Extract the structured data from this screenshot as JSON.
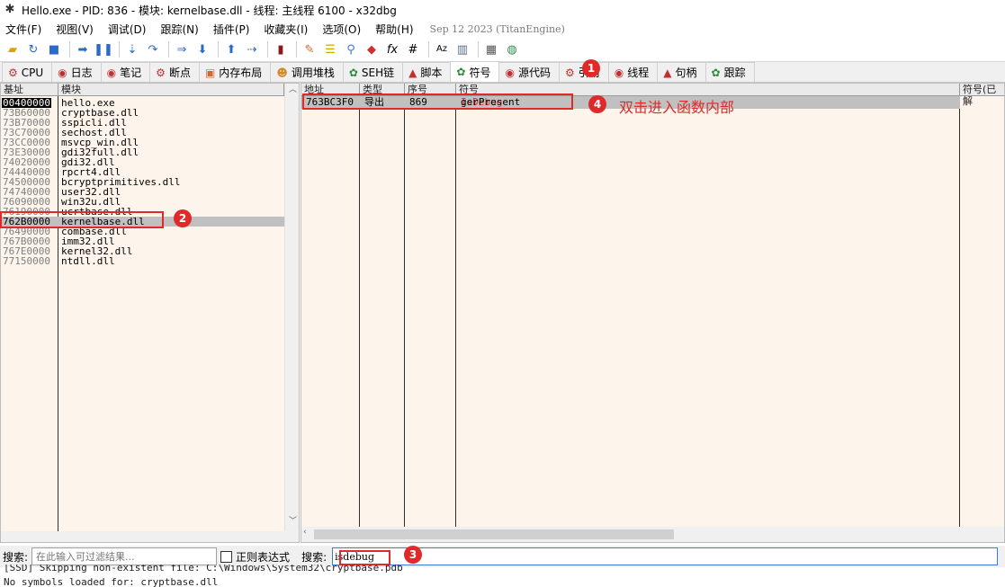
{
  "window": {
    "title": "Hello.exe - PID: 836 - 模块: kernelbase.dll - 线程: 主线程 6100 - x32dbg"
  },
  "menu": {
    "items": [
      "文件(F)",
      "视图(V)",
      "调试(D)",
      "跟踪(N)",
      "插件(P)",
      "收藏夹(I)",
      "选项(O)",
      "帮助(H)"
    ],
    "build": "Sep 12 2023 (TitanEngine)"
  },
  "tabs": [
    {
      "label": "CPU",
      "icon": "cpu-icon"
    },
    {
      "label": "日志",
      "icon": "log-icon"
    },
    {
      "label": "笔记",
      "icon": "notes-icon"
    },
    {
      "label": "断点",
      "icon": "breakpoint-icon"
    },
    {
      "label": "内存布局",
      "icon": "memory-map-icon"
    },
    {
      "label": "调用堆栈",
      "icon": "call-stack-icon"
    },
    {
      "label": "SEH链",
      "icon": "seh-icon"
    },
    {
      "label": "脚本",
      "icon": "script-icon"
    },
    {
      "label": "符号",
      "icon": "symbols-icon"
    },
    {
      "label": "源代码",
      "icon": "source-icon"
    },
    {
      "label": "引用",
      "icon": "references-icon"
    },
    {
      "label": "线程",
      "icon": "threads-icon"
    },
    {
      "label": "句柄",
      "icon": "handles-icon"
    },
    {
      "label": "跟踪",
      "icon": "trace-icon"
    }
  ],
  "modules": {
    "headers": [
      "基址",
      "模块"
    ],
    "rows": [
      {
        "base": "00400000",
        "name": "hello.exe"
      },
      {
        "base": "73B60000",
        "name": "cryptbase.dll"
      },
      {
        "base": "73B70000",
        "name": "sspicli.dll"
      },
      {
        "base": "73C70000",
        "name": "sechost.dll"
      },
      {
        "base": "73CC0000",
        "name": "msvcp_win.dll"
      },
      {
        "base": "73E30000",
        "name": "gdi32full.dll"
      },
      {
        "base": "74020000",
        "name": "gdi32.dll"
      },
      {
        "base": "74440000",
        "name": "rpcrt4.dll"
      },
      {
        "base": "74500000",
        "name": "bcryptprimitives.dll"
      },
      {
        "base": "74740000",
        "name": "user32.dll"
      },
      {
        "base": "76090000",
        "name": "win32u.dll"
      },
      {
        "base": "76190000",
        "name": "ucrtbase.dll"
      },
      {
        "base": "762B0000",
        "name": "kernelbase.dll"
      },
      {
        "base": "76490000",
        "name": "combase.dll"
      },
      {
        "base": "767B0000",
        "name": "imm32.dll"
      },
      {
        "base": "767E0000",
        "name": "kernel32.dll"
      },
      {
        "base": "77150000",
        "name": "ntdll.dll"
      }
    ]
  },
  "symbols": {
    "headers": [
      "地址",
      "类型",
      "序号",
      "符号",
      "符号(已解"
    ],
    "row": {
      "address": "763BC3F0",
      "type": "导出",
      "ordinal": "869",
      "name_highlight": "IsDebug",
      "name_rest": "gerPresent"
    }
  },
  "search": {
    "label1": "搜索:",
    "filter_placeholder": "在此输入可过滤结果...",
    "regex_label": "正则表达式",
    "label2": "搜索:",
    "value": "isdebug"
  },
  "log": {
    "line1": "[SSD] Skipping non-existent file: C:\\Windows\\System32\\cryptbase.pdb",
    "line2": "No symbols loaded for: cryptbase.dll"
  },
  "annotations": {
    "badges": [
      "1",
      "2",
      "3",
      "4"
    ],
    "note": "双击进入函数内部"
  },
  "colors": {
    "panel_bg": "#fdf5ec",
    "highlight_bg": "#c0c0c0",
    "annotation_red": "#e02a2a",
    "symbol_match": "#e03030"
  }
}
